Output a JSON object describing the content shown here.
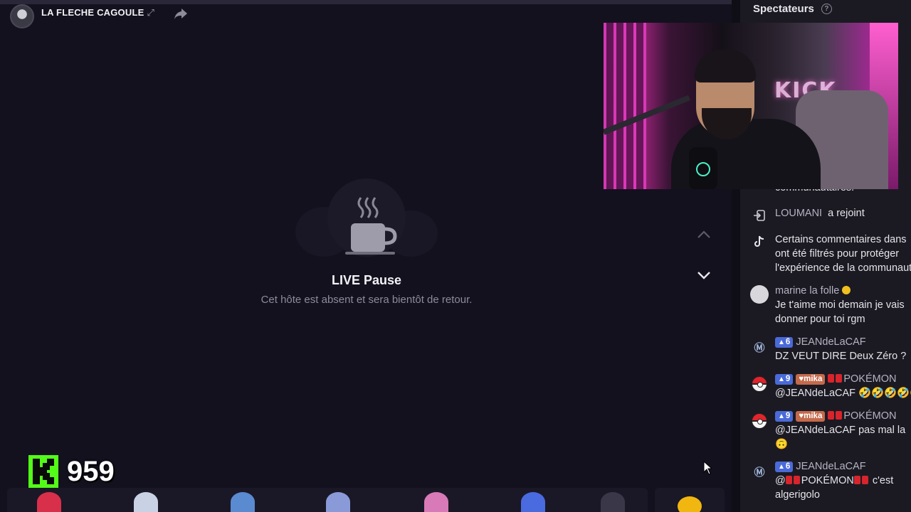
{
  "host": {
    "name": "LA FLECHE CAGOULE",
    "spark": "⤢"
  },
  "pause": {
    "title": "LIVE Pause",
    "subtitle": "Cet hôte est absent et sera bientôt de retour."
  },
  "viewer_count": "959",
  "sidebar": {
    "title": "Spectateurs",
    "help": "?"
  },
  "webcam": {
    "sign": "KICK"
  },
  "chat": {
    "top_fragment": "communautaires.",
    "messages": [
      {
        "type": "join",
        "icon": "join-icon",
        "user": "LOUMANI",
        "text": "a rejoint"
      },
      {
        "type": "system",
        "icon": "tiktok-icon",
        "lines": [
          "Certains commentaires dans",
          "ont été filtrés pour protéger",
          "l'expérience de la communauté"
        ]
      },
      {
        "type": "msg",
        "user": "marine la folle",
        "lines": [
          "Je t'aime moi demain je vais",
          "donner pour toi rgm"
        ]
      },
      {
        "type": "msg",
        "level": "6",
        "user": "JEANdeLaCAF",
        "lines": [
          "DZ VEUT DIRE Deux Zéro ?"
        ]
      },
      {
        "type": "msg",
        "level": "9",
        "fan": "mika",
        "user": "POKÉMON",
        "lines": [
          "@JEANdeLaCAF 🤣🤣🤣🤣🤣"
        ]
      },
      {
        "type": "msg",
        "level": "9",
        "fan": "mika",
        "user": "POKÉMON",
        "lines": [
          "@JEANdeLaCAF pas mal la",
          "🙃"
        ]
      },
      {
        "type": "msg",
        "level": "6",
        "user": "JEANdeLaCAF",
        "mention": "@",
        "mention_user": "POKÉMON",
        "after": "c'est",
        "lines": [
          "algerigolo"
        ]
      }
    ]
  },
  "colors": {
    "kick_green": "#53fc18",
    "level_badge": "#4a6ad8",
    "fan_badge": "#c46a4c"
  }
}
